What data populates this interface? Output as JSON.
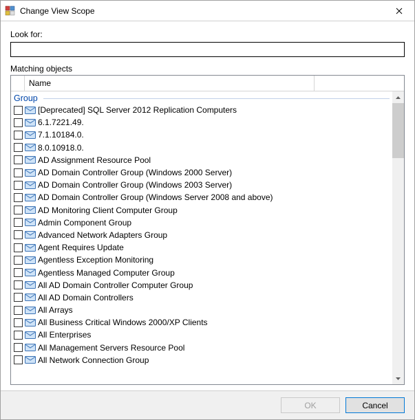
{
  "window": {
    "title": "Change View Scope"
  },
  "labels": {
    "look_for": "Look for:",
    "matching": "Matching objects",
    "name_col": "Name",
    "group_header": "Group"
  },
  "search": {
    "value": ""
  },
  "buttons": {
    "ok": "OK",
    "cancel": "Cancel"
  },
  "items": [
    {
      "name": "[Deprecated] SQL Server 2012 Replication Computers"
    },
    {
      "name": "6.1.7221.49."
    },
    {
      "name": "7.1.10184.0."
    },
    {
      "name": "8.0.10918.0."
    },
    {
      "name": "AD Assignment Resource Pool"
    },
    {
      "name": "AD Domain Controller Group (Windows 2000 Server)"
    },
    {
      "name": "AD Domain Controller Group (Windows 2003 Server)"
    },
    {
      "name": "AD Domain Controller Group (Windows Server 2008 and above)"
    },
    {
      "name": "AD Monitoring Client Computer Group"
    },
    {
      "name": "Admin Component Group"
    },
    {
      "name": "Advanced Network Adapters Group"
    },
    {
      "name": "Agent Requires Update"
    },
    {
      "name": "Agentless Exception Monitoring"
    },
    {
      "name": "Agentless Managed Computer Group"
    },
    {
      "name": "All AD Domain Controller Computer Group"
    },
    {
      "name": "All AD Domain Controllers"
    },
    {
      "name": "All Arrays"
    },
    {
      "name": "All Business Critical Windows 2000/XP Clients"
    },
    {
      "name": "All Enterprises"
    },
    {
      "name": "All Management Servers Resource Pool"
    },
    {
      "name": "All Network Connection Group"
    }
  ]
}
